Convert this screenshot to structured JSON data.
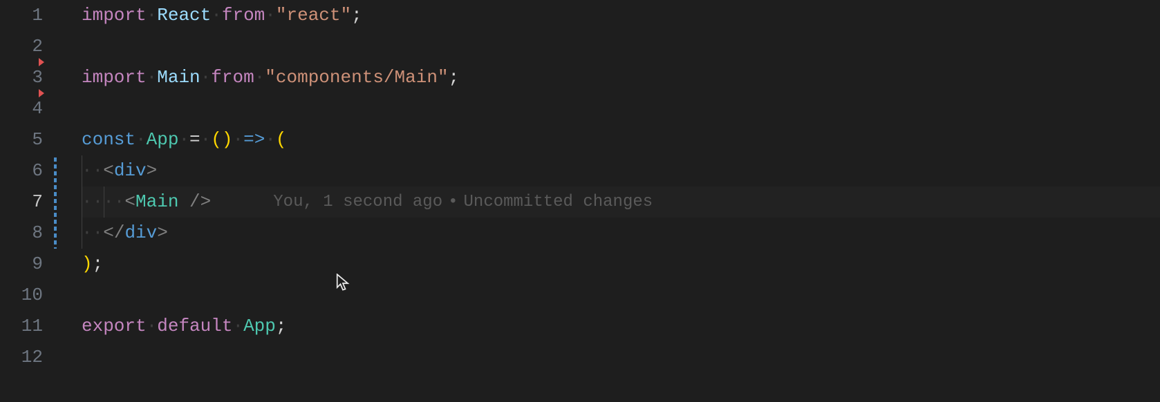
{
  "lines": [
    {
      "num": "1"
    },
    {
      "num": "2",
      "marker": true
    },
    {
      "num": "3",
      "marker": true
    },
    {
      "num": "4"
    },
    {
      "num": "5"
    },
    {
      "num": "6"
    },
    {
      "num": "7",
      "active": true
    },
    {
      "num": "8"
    },
    {
      "num": "9"
    },
    {
      "num": "10"
    },
    {
      "num": "11"
    },
    {
      "num": "12"
    }
  ],
  "tokens": {
    "import": "import",
    "from": "from",
    "const": "const",
    "export": "export",
    "default": "default",
    "React": "React",
    "Main": "Main",
    "App": "App",
    "str_react": "\"react\"",
    "str_main": "\"components/Main\"",
    "eq": "=",
    "arrow": "=>",
    "lparen": "(",
    "rparen": ")",
    "semi": ";",
    "div_open": "<div>",
    "div_close": "</div>",
    "main_selfclose_open": "<",
    "main_selfclose_name": "Main",
    "main_selfclose_end": " />",
    "lparen_empty": "()",
    "ws2": "··",
    "ws4": "····"
  },
  "codelens": {
    "author": "You, 1 second ago",
    "sep": "•",
    "status": "Uncommitted changes"
  }
}
